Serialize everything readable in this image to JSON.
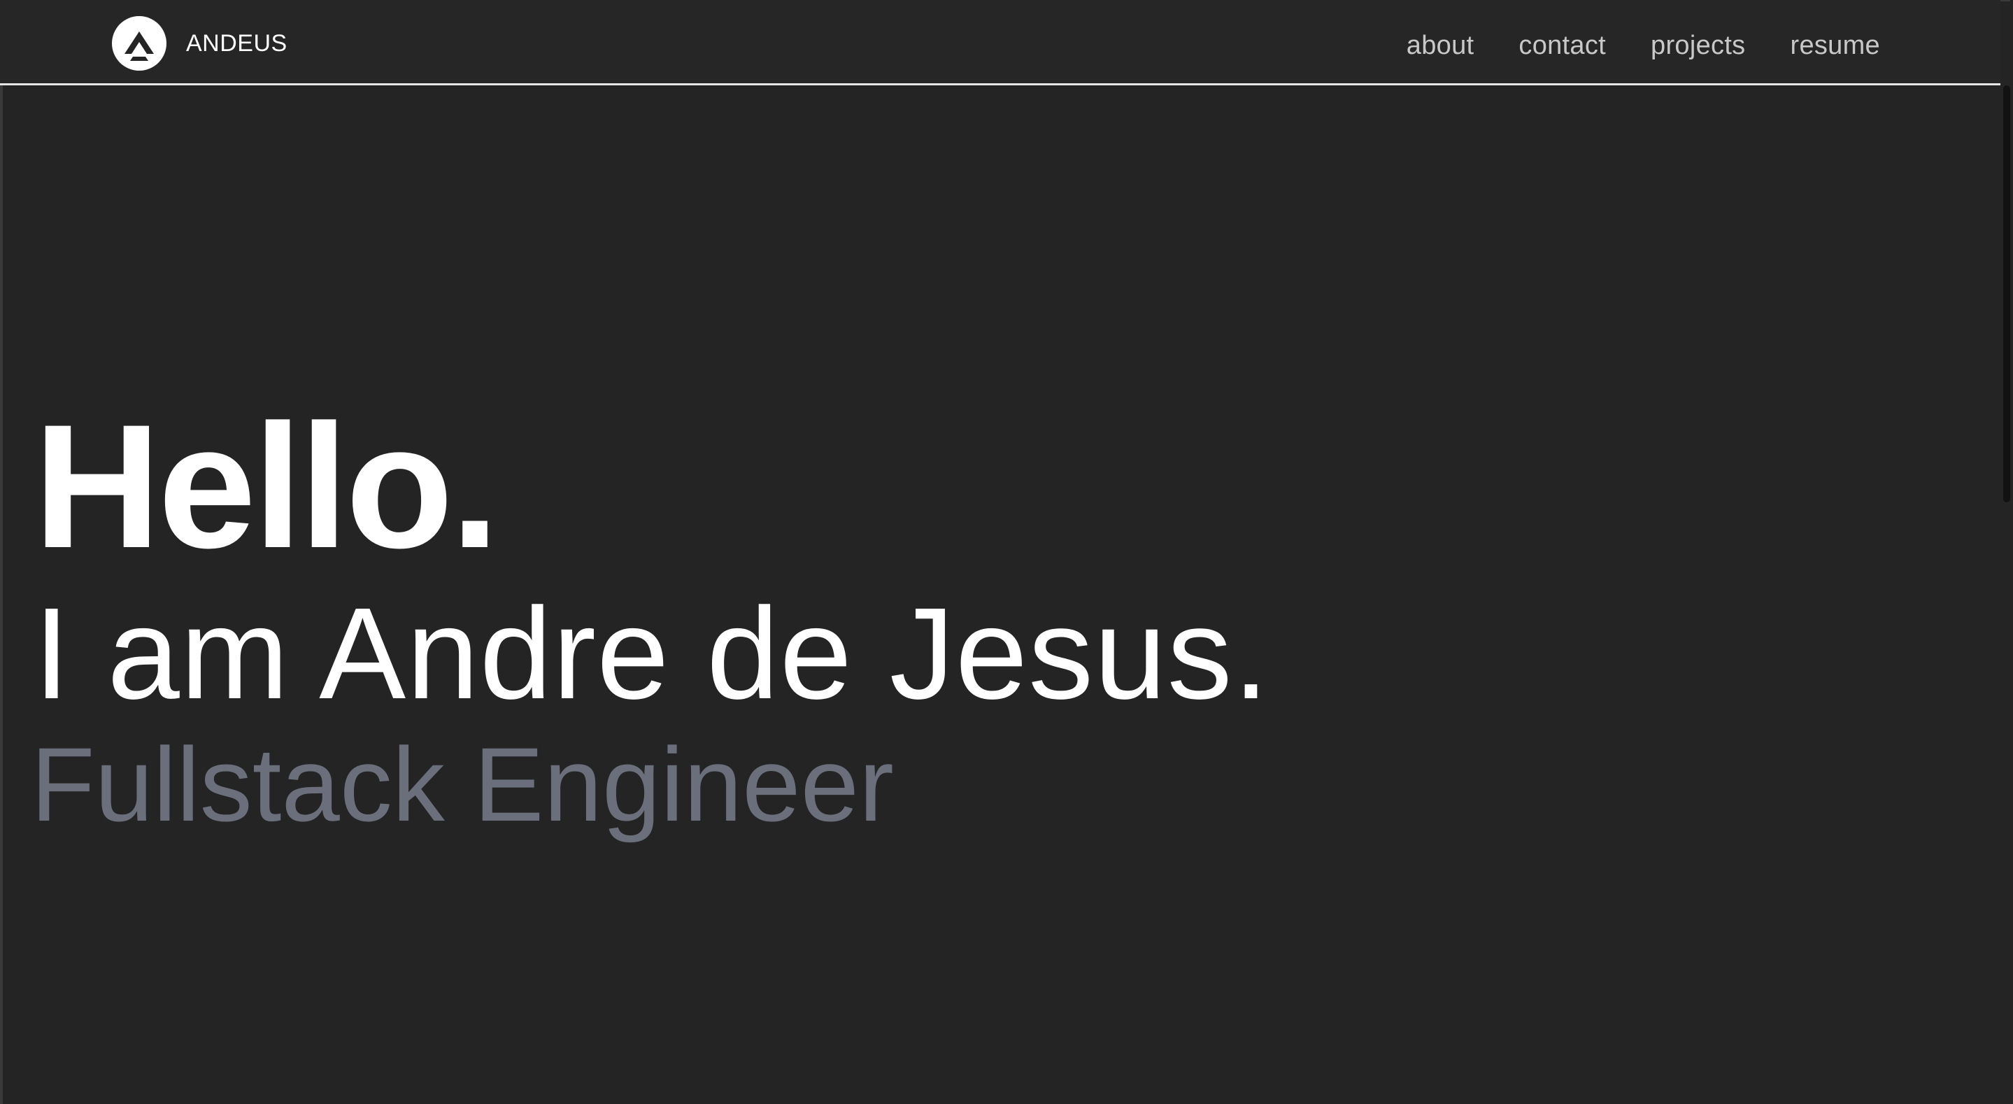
{
  "nav": {
    "brand": "ANDEUS",
    "links": [
      {
        "label": "about"
      },
      {
        "label": "contact"
      },
      {
        "label": "projects"
      },
      {
        "label": "resume"
      }
    ]
  },
  "hero": {
    "greeting": "Hello.",
    "name": "I am Andre de Jesus.",
    "role": "Fullstack Engineer"
  },
  "icons": {
    "logo": "andeus-logo-icon"
  },
  "colors": {
    "background": "#242424",
    "text": "#ffffff",
    "nav_link": "#c8c8c8",
    "role": "#6b6f7b",
    "nav_border": "#e6e6e6"
  }
}
